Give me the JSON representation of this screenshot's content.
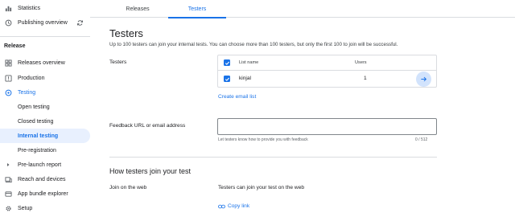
{
  "sidebar": {
    "top_items": [
      {
        "label": "Statistics",
        "icon": "bar-chart-icon"
      },
      {
        "label": "Publishing overview",
        "icon": "publish-icon"
      }
    ],
    "section_title": "Release",
    "items": [
      {
        "label": "Releases overview",
        "icon": "grid-icon"
      },
      {
        "label": "Production",
        "icon": "alert-icon"
      },
      {
        "label": "Testing",
        "icon": "testing-icon"
      },
      {
        "label": "Open testing"
      },
      {
        "label": "Closed testing"
      },
      {
        "label": "Internal testing"
      },
      {
        "label": "Pre-registration"
      },
      {
        "label": "Pre-launch report",
        "icon": "caret-right-icon"
      },
      {
        "label": "Reach and devices",
        "icon": "devices-icon"
      },
      {
        "label": "App bundle explorer",
        "icon": "bundle-icon"
      },
      {
        "label": "Setup",
        "icon": "gear-icon"
      }
    ]
  },
  "tabs": [
    {
      "label": "Releases"
    },
    {
      "label": "Testers"
    }
  ],
  "main": {
    "title": "Testers",
    "description": "Up to 100 testers can join your internal tests. You can choose more than 100 testers, but only the first 100 to join will be successful.",
    "testers_label": "Testers",
    "table": {
      "columns": [
        "List name",
        "Users"
      ],
      "rows": [
        {
          "name": "kinjal",
          "users": "1"
        }
      ]
    },
    "create_email_list": "Create email list",
    "feedback_label": "Feedback URL or email address",
    "feedback_value": "",
    "feedback_helper": "Let testers know how to provide you with feedback",
    "feedback_counter": "0 / 512",
    "how_title": "How testers join your test",
    "join_web_label": "Join on the web",
    "join_web_text": "Testers can join your test on the web",
    "copy_link": "Copy link"
  },
  "colors": {
    "accent": "#1a73e8",
    "active_bg": "#e8f0fe",
    "divider": "#dadce0"
  }
}
